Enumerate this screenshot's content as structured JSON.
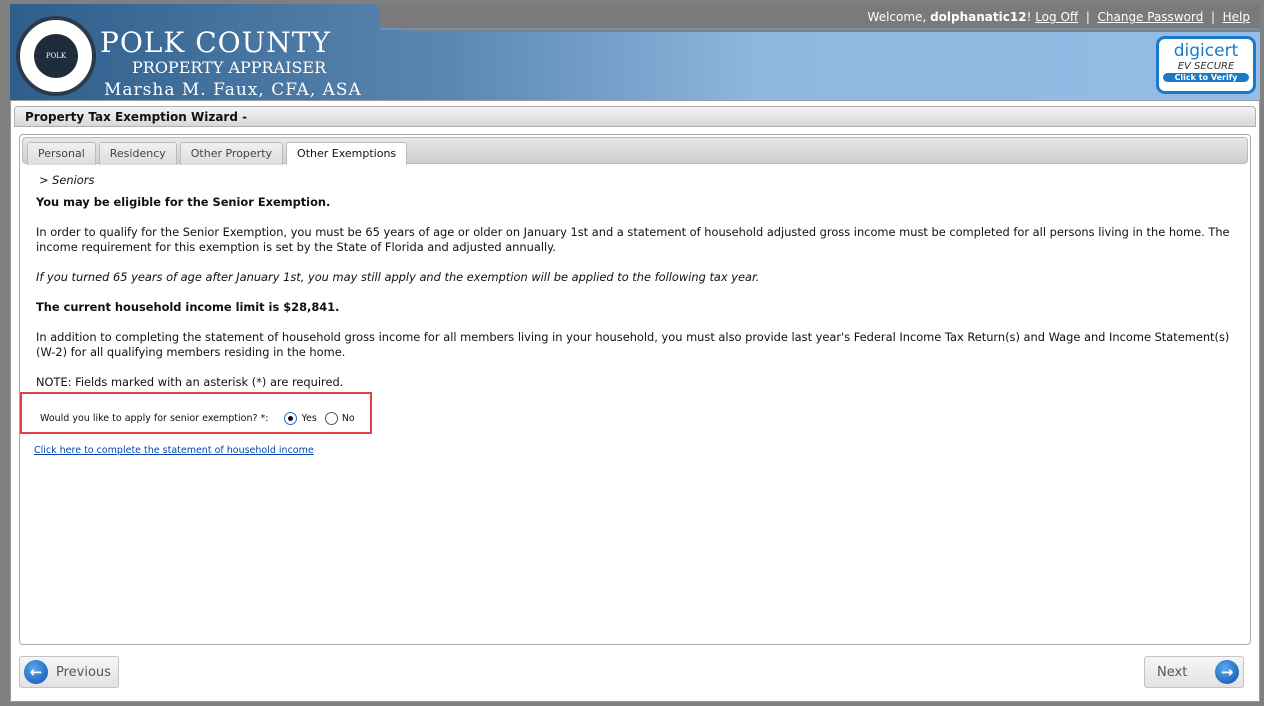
{
  "header": {
    "logo_text": "PROPERTY APPRAISER POLK COUNTY",
    "title": "POLK COUNTY",
    "subtitle": "PROPERTY APPRAISER",
    "appraiser": "Marsha M. Faux, CFA, ASA",
    "welcome_prefix": "Welcome, ",
    "username": "dolphanatic12",
    "welcome_suffix": "!",
    "logoff": "Log Off",
    "change_password": "Change Password",
    "help": "Help",
    "sep": "|",
    "badge": {
      "brand": "digicert",
      "line": "EV SECURE",
      "verify": "Click to Verify"
    }
  },
  "panel": {
    "title": "Property Tax Exemption Wizard -"
  },
  "tabs": [
    {
      "label": "Personal"
    },
    {
      "label": "Residency"
    },
    {
      "label": "Other Property"
    },
    {
      "label": "Other Exemptions",
      "active": true
    }
  ],
  "content": {
    "crumb": ">  Seniors",
    "heading": "You may be eligible for the Senior Exemption.",
    "p1": "In order to qualify for the Senior Exemption, you must be 65 years of age or older on January 1st and a statement of household adjusted gross income must be completed for all persons living in the home. The income requirement for this exemption is set by the State of Florida and adjusted annually.",
    "p2": "If you turned 65 years of age after January 1st, you may still apply and the exemption will be applied to the following tax year.",
    "limit": "The current household income limit is $28,841.",
    "p3": "In addition to completing the statement of household gross income for all members living in your household, you must also provide last year's Federal Income Tax Return(s) and Wage and Income Statement(s) (W-2) for all qualifying members residing in the home.",
    "note": "NOTE: Fields marked with an asterisk (*) are required.",
    "question": "Would you like to apply for senior exemption? *:",
    "yes": "Yes",
    "no": "No",
    "selected": "Yes",
    "link": "Click here to complete the statement of household income"
  },
  "nav": {
    "previous": "Previous",
    "next": "Next"
  },
  "colors": {
    "highlight": "#e04040",
    "link": "#0645ad",
    "accent": "#1a7ac4"
  }
}
